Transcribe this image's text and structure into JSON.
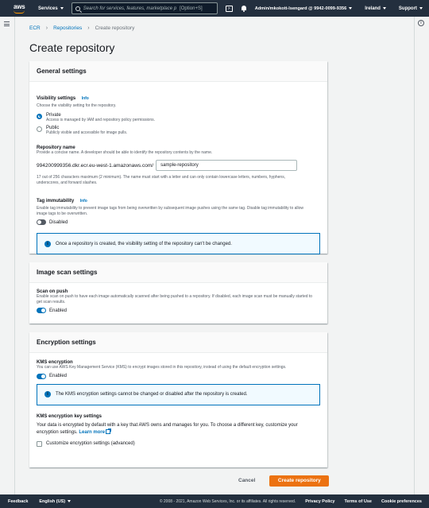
{
  "topnav": {
    "logo_text": "aws",
    "services_label": "Services",
    "search_placeholder": "Search for services, features, marketplace p",
    "search_shortcut": "[Option+S]",
    "account_label": "Admin/mkokott-lsengard @ 9942-0099-9356",
    "region_label": "Ireland",
    "support_label": "Support"
  },
  "breadcrumb": {
    "items": [
      "ECR",
      "Repositories",
      "Create repository"
    ]
  },
  "page": {
    "title": "Create repository"
  },
  "general": {
    "header": "General settings",
    "visibility_label": "Visibility settings",
    "info": "Info",
    "visibility_desc": "Choose the visibility setting for the repository.",
    "private_label": "Private",
    "private_desc": "Access is managed by IAM and repository policy permissions.",
    "public_label": "Public",
    "public_desc": "Publicly visible and accessible for image pulls.",
    "selected_visibility": "Private",
    "repo_name_label": "Repository name",
    "repo_name_desc": "Provide a concise name. A developer should be able to identify the repository contents by the name.",
    "repo_prefix": "994200999356.dkr.ecr.eu-west-1.amazonaws.com/",
    "repo_name_value": "sample-repository",
    "repo_constraint": "17 out of 256 characters maximum (2 minimum). The name must start with a letter and can only contain lowercase letters, numbers, hyphens, underscores, and forward slashes.",
    "tag_immutability_label": "Tag immutability",
    "tag_immutability_desc": "Enable tag immutability to prevent image tags from being overwritten by subsequent image pushes using the same tag. Disable tag immutability to allow image tags to be overwritten.",
    "tag_immutability_state": "Disabled",
    "alert_text": "Once a repository is created, the visibility setting of the repository can't be changed."
  },
  "scan": {
    "header": "Image scan settings",
    "label": "Scan on push",
    "desc": "Enable scan on push to have each image automatically scanned after being pushed to a repository. If disabled, each image scan must be manually started to get scan results.",
    "state": "Enabled"
  },
  "encryption": {
    "header": "Encryption settings",
    "kms_label": "KMS encryption",
    "kms_desc": "You can use AWS Key Management Service (KMS) to encrypt images stored in this repository, instead of using the default encryption settings.",
    "kms_state": "Enabled",
    "alert_text": "The KMS encryption settings cannot be changed or disabled after the repository is created.",
    "key_settings_label": "KMS encryption key settings",
    "key_settings_text": "Your data is encrypted by default with a key that AWS owns and manages for you. To choose a different key, customize your encryption settings.",
    "learn_more": "Learn more",
    "customize_label": "Customize encryption settings (advanced)"
  },
  "actions": {
    "cancel_label": "Cancel",
    "create_label": "Create repository"
  },
  "footer": {
    "feedback": "Feedback",
    "language": "English (US)",
    "copyright": "© 2008 - 2021, Amazon Web Services, Inc. or its affiliates. All rights reserved.",
    "privacy": "Privacy Policy",
    "terms": "Terms of Use",
    "cookies": "Cookie preferences"
  },
  "colors": {
    "nav_bg": "#232f3e",
    "primary_button": "#ec7211",
    "link": "#0073bb",
    "info_alert_bg": "#f1faff",
    "page_bg": "#f2f3f3"
  }
}
